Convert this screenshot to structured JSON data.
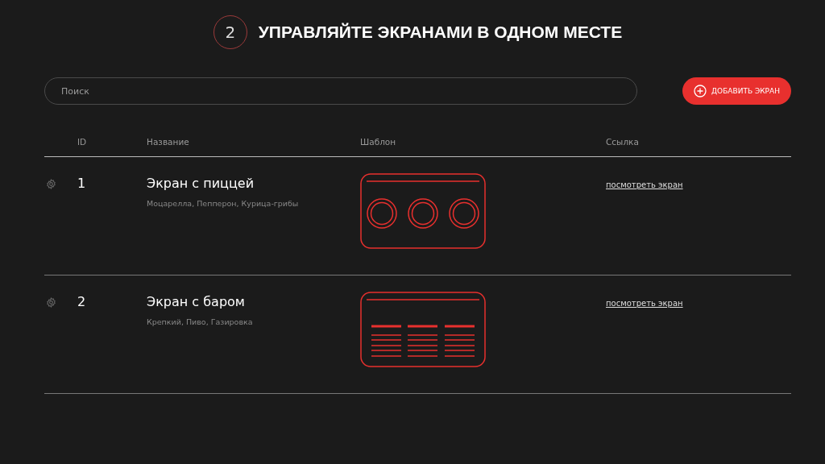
{
  "header": {
    "step": "2",
    "title": "УПРАВЛЯЙТЕ ЭКРАНАМИ В ОДНОМ МЕСТЕ"
  },
  "search": {
    "placeholder": "Поиск"
  },
  "add_button": {
    "label": "ДОБАВИТЬ ЭКРАН"
  },
  "table": {
    "columns": [
      "ID",
      "Название",
      "Шаблон",
      "Ссылка"
    ],
    "rows": [
      {
        "id": "1",
        "name": "Экран с пиццей",
        "description": "Моцарелла, Пепперон, Курица-грибы",
        "template": {
          "kind": "circles"
        },
        "link": "посмотреть экран"
      },
      {
        "id": "2",
        "name": "Экран с баром",
        "description": "Крепкий, Пиво, Газировка",
        "template": {
          "kind": "menu"
        },
        "link": "посмотреть экран"
      }
    ]
  }
}
